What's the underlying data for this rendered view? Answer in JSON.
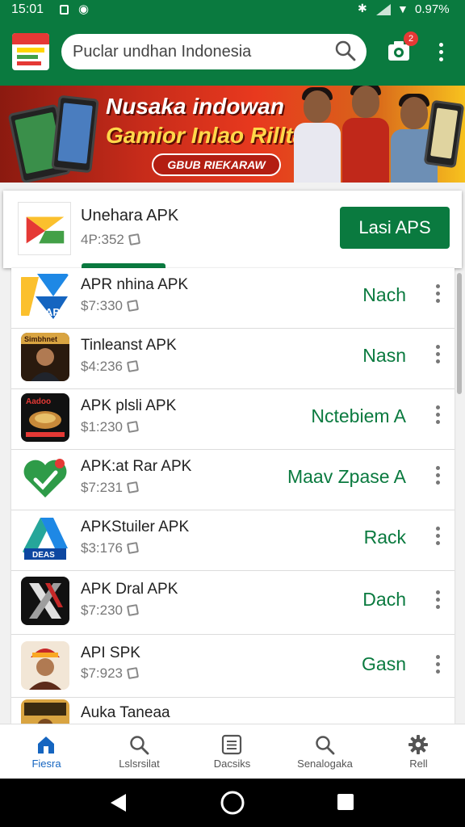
{
  "status_bar": {
    "time": "15:01",
    "battery": "0.97%"
  },
  "header": {
    "search_placeholder": "Puclar undhan Indonesia",
    "notification_count": "2",
    "icons": [
      "store-logo-icon",
      "search-icon",
      "camera-icon",
      "more-vert-icon"
    ]
  },
  "banner": {
    "line1": "Nusaka indowan",
    "line2": "Gamior Inlao Rilltay",
    "button": "GBUB RIEKARAW"
  },
  "featured": {
    "name": "Unehara APK",
    "price": "4P:352",
    "install_label": "Lasi APS"
  },
  "apps": [
    {
      "name": "APR nhina APK",
      "price": "$7:330",
      "action": "Nach",
      "icon": "apk-logo-icon",
      "icon_text": "APK"
    },
    {
      "name": "Tinleanst APK",
      "price": "$4:236",
      "action": "Nasn",
      "icon": "portrait-icon",
      "icon_text": "Simbhnet"
    },
    {
      "name": "APK plsli APK",
      "price": "$1:230",
      "action": "Nctebiem A",
      "icon": "food-icon",
      "icon_text": "Aadoo"
    },
    {
      "name": "APK:at Rar APK",
      "price": "$7:231",
      "action": "Maav Zpase A",
      "icon": "heart-check-icon",
      "icon_text": ""
    },
    {
      "name": "APKStuiler APK",
      "price": "$3:176",
      "action": "Rack",
      "icon": "triangle-logo-icon",
      "icon_text": "DEAS"
    },
    {
      "name": "APK Dral APK",
      "price": "$7:230",
      "action": "Dach",
      "icon": "x-logo-icon",
      "icon_text": ""
    },
    {
      "name": "API SPK",
      "price": "$7:923",
      "action": "Gasn",
      "icon": "portrait-icon",
      "icon_text": ""
    },
    {
      "name": "Auka Taneaa",
      "price": "",
      "action": "",
      "icon": "game-icon",
      "icon_text": ""
    }
  ],
  "bottom_nav": [
    {
      "label": "Fiesra",
      "icon": "home-icon"
    },
    {
      "label": "Lslsrsilat",
      "icon": "search-icon"
    },
    {
      "label": "Dacsiks",
      "icon": "list-icon"
    },
    {
      "label": "Senalogaka",
      "icon": "search-icon"
    },
    {
      "label": "Rell",
      "icon": "gear-icon"
    }
  ],
  "colors": {
    "primary": "#0a7a3f",
    "active_nav": "#1565c0",
    "badge": "#e53935"
  }
}
